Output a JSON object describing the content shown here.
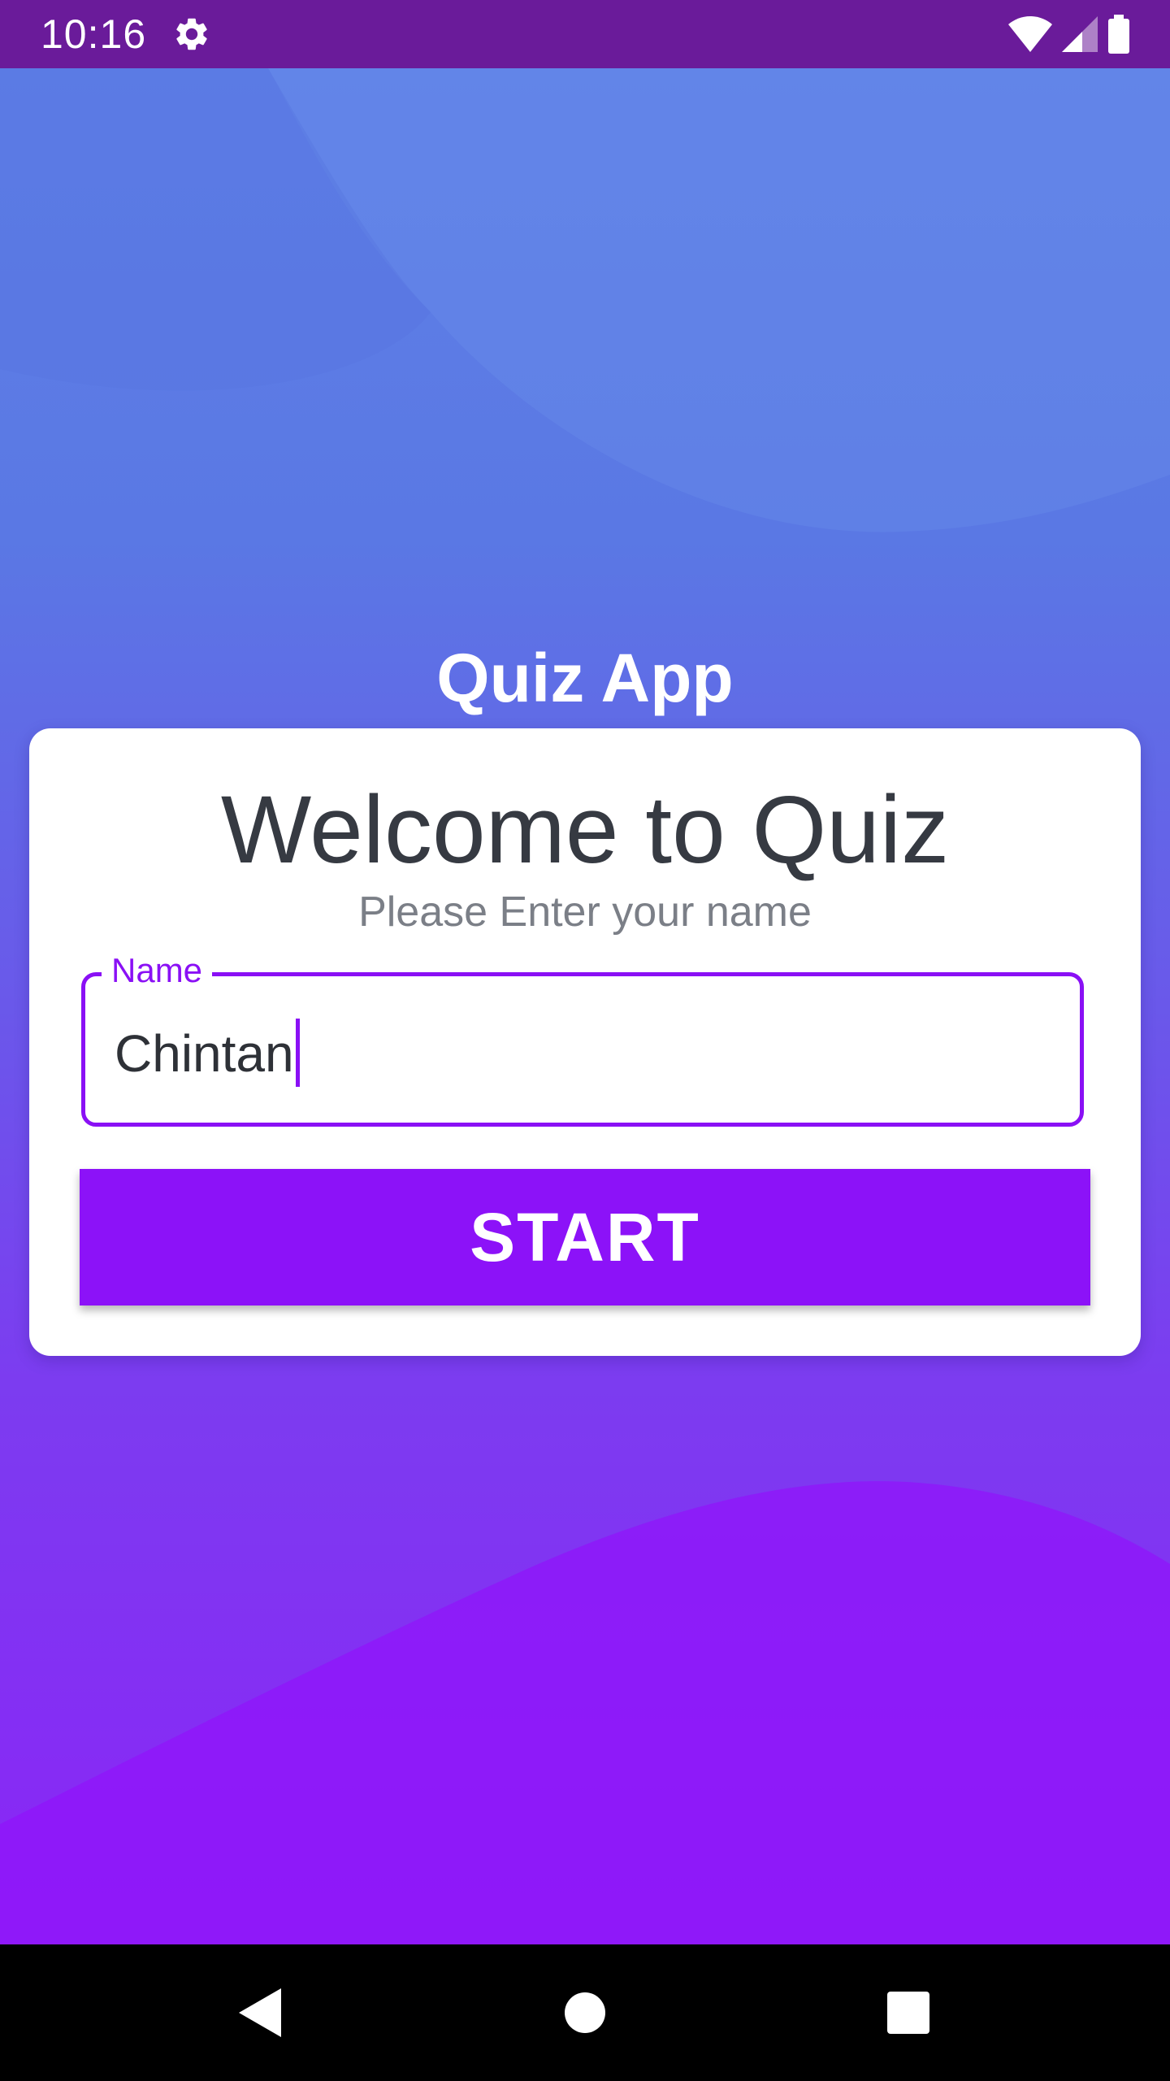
{
  "status_bar": {
    "time": "10:16",
    "icons": [
      "gear-icon",
      "wifi-icon",
      "signal-icon",
      "battery-icon"
    ]
  },
  "app": {
    "title": "Quiz App"
  },
  "card": {
    "heading": "Welcome to Quiz",
    "subheading": "Please Enter your name",
    "name_field": {
      "label": "Name",
      "value": "Chintan"
    },
    "start_label": "START"
  },
  "nav_bar": {
    "icons": [
      "back-icon",
      "home-icon",
      "recents-icon"
    ]
  },
  "colors": {
    "status_bar": "#6a1b9a",
    "accent": "#8c12f8",
    "gradient_top": "#5f80e6",
    "gradient_bottom": "#8a25f6",
    "card": "#ffffff"
  }
}
